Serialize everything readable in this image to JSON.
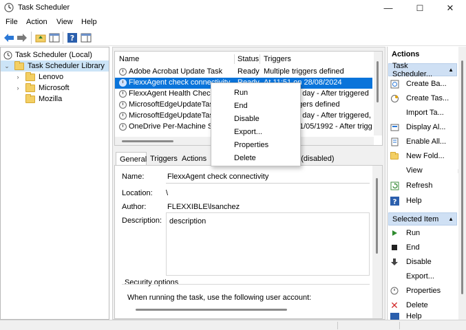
{
  "window": {
    "title": "Task Scheduler"
  },
  "window_controls": {
    "minimize": "—",
    "maximize": "☐",
    "close": "✕"
  },
  "menubar": {
    "items": [
      "File",
      "Action",
      "View",
      "Help"
    ]
  },
  "tree": {
    "root": "Task Scheduler (Local)",
    "library": "Task Scheduler Library",
    "children": [
      "Lenovo",
      "Microsoft",
      "Mozilla"
    ]
  },
  "tasklist": {
    "columns": [
      "Name",
      "Status",
      "Triggers"
    ],
    "rows": [
      {
        "name": "Adobe Acrobat Update Task",
        "status": "Ready",
        "triggers": "Multiple triggers defined"
      },
      {
        "name": "FlexxAgent check connectivity",
        "status": "Ready",
        "triggers": "At 11:51 on 28/08/2024"
      },
      {
        "name": "FlexxAgent Health Check",
        "status": "",
        "triggers": "ry day - After triggered"
      },
      {
        "name": "MicrosoftEdgeUpdateTaskM",
        "status": "",
        "triggers": "ggers defined"
      },
      {
        "name": "MicrosoftEdgeUpdateTaskM",
        "status": "",
        "triggers": "ry day - After triggered,"
      },
      {
        "name": "OneDrive Per-Machine Sta",
        "status": "",
        "triggers": "1/05/1992 - After trigg"
      }
    ]
  },
  "details": {
    "tabs": [
      "General",
      "Triggers",
      "Actions",
      "ry (disabled)"
    ],
    "name_label": "Name:",
    "name_value": "FlexxAgent check connectivity",
    "location_label": "Location:",
    "location_value": "\\",
    "author_label": "Author:",
    "author_value": "FLEXXIBLE\\lsanchez",
    "description_label": "Description:",
    "description_value": "description",
    "security_label": "Security options",
    "security_text": "When running the task, use the following user account:"
  },
  "context_menu": {
    "items": [
      "Run",
      "End",
      "Disable",
      "Export...",
      "Properties",
      "Delete"
    ]
  },
  "actions": {
    "title": "Actions",
    "section1": "Task Scheduler...",
    "section1_items": [
      "Create Ba...",
      "Create Tas...",
      "Import Ta...",
      "Display Al...",
      "Enable All...",
      "New Fold...",
      "View",
      "Refresh",
      "Help"
    ],
    "section2": "Selected Item",
    "section2_items": [
      "Run",
      "End",
      "Disable",
      "Export...",
      "Properties",
      "Delete",
      "Help"
    ]
  },
  "colors": {
    "selection": "#0a74da",
    "header_bg": "#cfe0f4"
  }
}
